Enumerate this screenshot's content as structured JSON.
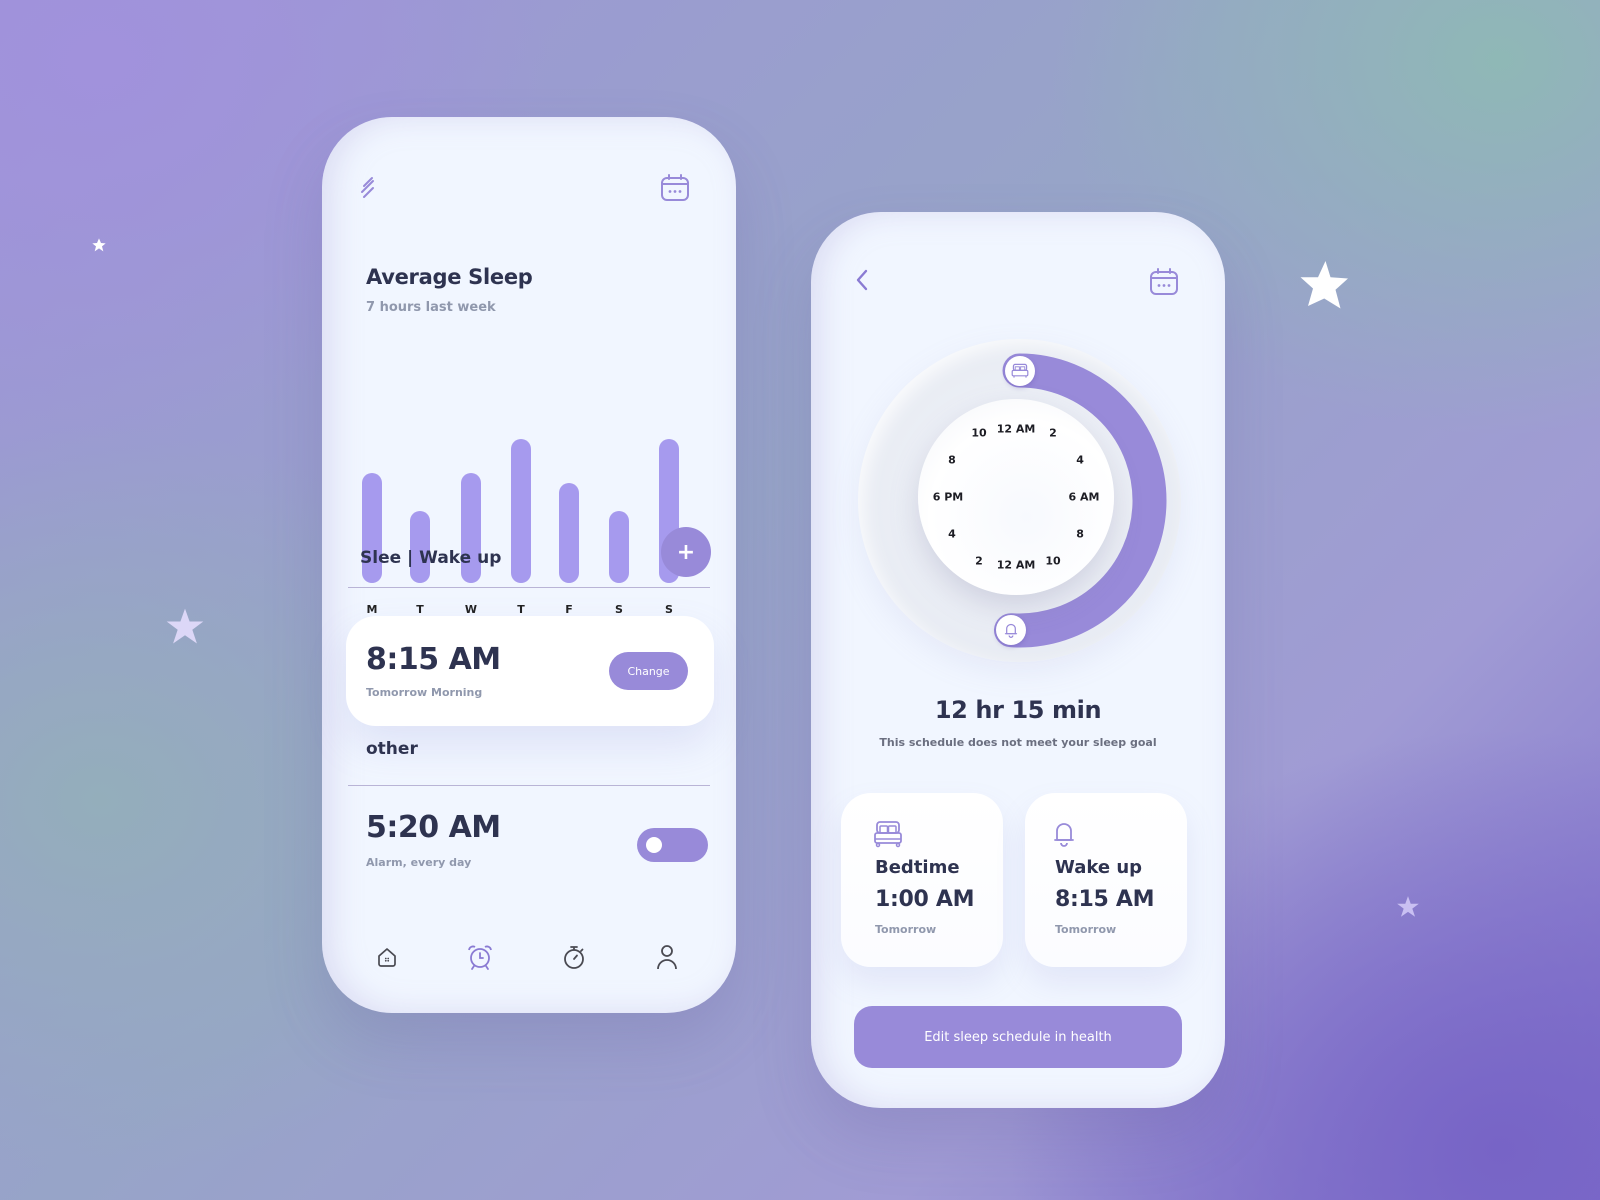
{
  "colors": {
    "accent": "#988ad9",
    "bar": "#a69aee",
    "text_dark": "#2e3350",
    "text_muted": "#9098ad",
    "card_bg": "#ffffff",
    "phone_bg": "#f1f6ff"
  },
  "sleep_overview": {
    "header": {
      "menu_icon": "menu-lines-icon",
      "calendar_icon": "calendar-icon"
    },
    "title": "Average Sleep",
    "subtitle": "7 hours last week",
    "section_title": "Slee | Wake up",
    "add_button": "+",
    "primary_alarm": {
      "time": "8:15 AM",
      "note": "Tomorrow Morning",
      "change_label": "Change"
    },
    "other_title": "other",
    "other_alarm": {
      "time": "5:20 AM",
      "note": "Alarm, every day",
      "enabled": false
    },
    "bottom_nav": [
      {
        "name": "home",
        "icon": "home-icon",
        "active": false
      },
      {
        "name": "alarm",
        "icon": "alarm-clock-icon",
        "active": true
      },
      {
        "name": "timer",
        "icon": "stopwatch-icon",
        "active": false
      },
      {
        "name": "profile",
        "icon": "user-icon",
        "active": false
      }
    ]
  },
  "chart_data": {
    "type": "bar",
    "title": "Average Sleep",
    "subtitle": "7 hours last week",
    "categories": [
      "M",
      "T",
      "W",
      "T",
      "F",
      "S",
      "S"
    ],
    "values": [
      7.0,
      4.6,
      7.0,
      9.2,
      6.4,
      4.6,
      9.2
    ],
    "xlabel": "",
    "ylabel": "",
    "ylim": [
      0,
      9.2
    ],
    "grid": false,
    "legend": "none",
    "note": "No y-axis shown; values estimated relative to bar heights"
  },
  "schedule": {
    "header": {
      "back_icon": "chevron-left-icon",
      "calendar_icon": "calendar-icon"
    },
    "dial": {
      "labels": [
        "12 AM",
        "2",
        "4",
        "6 AM",
        "8",
        "10",
        "12 AM",
        "2",
        "4",
        "6 PM",
        "8",
        "10"
      ],
      "bedtime_handle_icon": "bed-icon",
      "wake_handle_icon": "bell-icon",
      "bedtime_hours": 0,
      "wake_hours": 12.25
    },
    "duration": "12 hr 15 min",
    "goal_note": "This schedule does not meet your sleep goal",
    "cards": [
      {
        "icon": "bed-icon",
        "label": "Bedtime",
        "time": "1:00 AM",
        "note": "Tomorrow"
      },
      {
        "icon": "bell-icon",
        "label": "Wake up",
        "time": "8:15 AM",
        "note": "Tomorrow"
      }
    ],
    "edit_button": "Edit sleep schedule in health"
  }
}
